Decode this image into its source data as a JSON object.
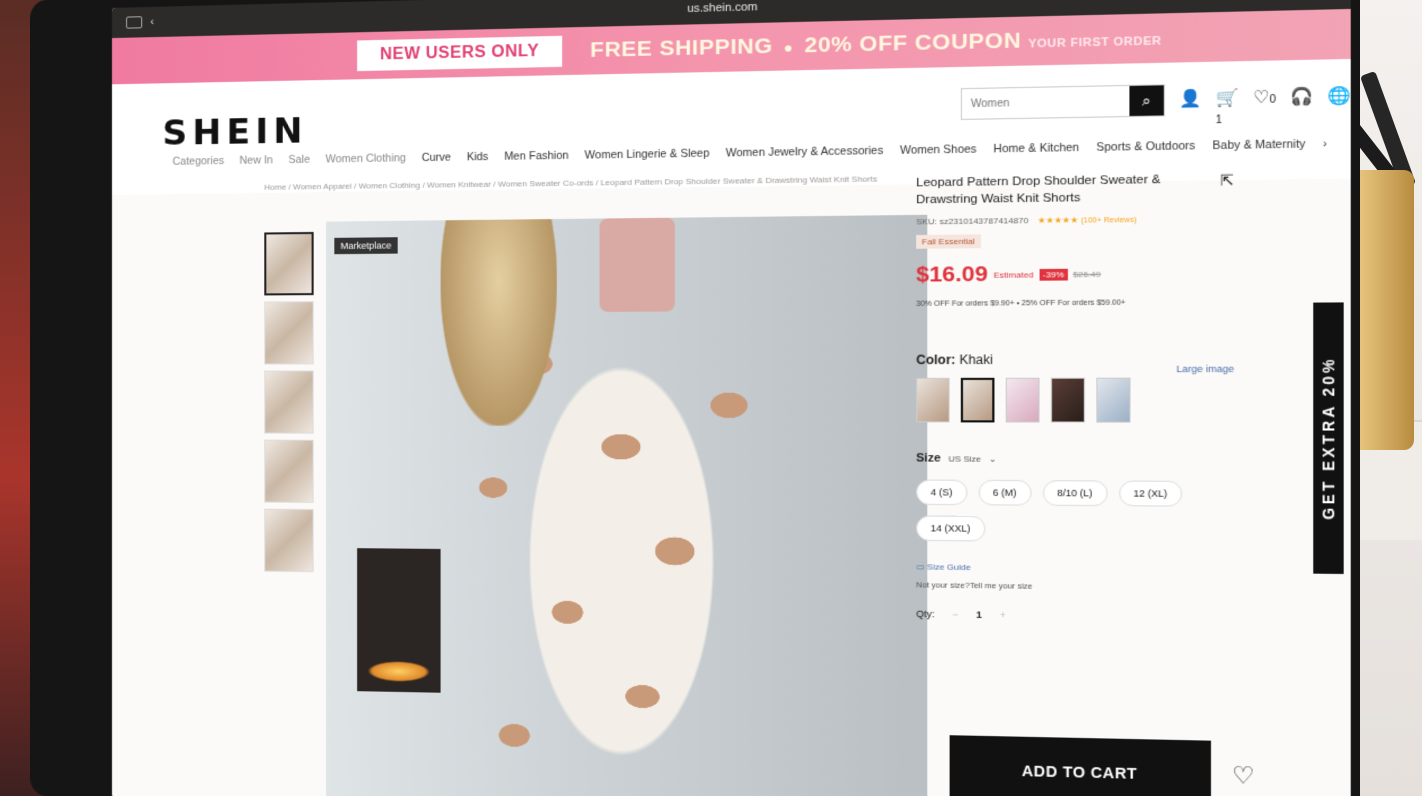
{
  "browser": {
    "url": "us.shein.com"
  },
  "promo": {
    "new_users": "NEW USERS ONLY",
    "free_shipping": "FREE SHIPPING",
    "coupon": "20% OFF COUPON",
    "coupon_sub": "YOUR FIRST ORDER"
  },
  "header": {
    "logo": "SHEIN",
    "search_placeholder": "Women",
    "cart_count": "1",
    "wishlist_count": "0"
  },
  "nav": {
    "items": [
      "Categories",
      "New In",
      "Sale",
      "Women Clothing",
      "Curve",
      "Kids",
      "Men Fashion",
      "Women Lingerie & Sleep",
      "Women Jewelry & Accessories",
      "Women Shoes",
      "Home & Kitchen",
      "Sports & Outdoors",
      "Baby & Maternity"
    ]
  },
  "breadcrumb": "Home / Women Apparel / Women Clothing / Women Knitwear / Women Sweater Co-ords / Leopard Pattern Drop Shoulder Sweater & Drawstring Waist Knit Shorts",
  "gallery": {
    "badge": "Marketplace"
  },
  "product": {
    "title": "Leopard Pattern Drop Shoulder Sweater & Drawstring Waist Knit Shorts",
    "sku": "SKU: sz2310143787414870",
    "reviews": "(100+ Reviews)",
    "tag": "Fall Essential",
    "price": "$16.09",
    "estimated": "Estimated",
    "discount": "-39%",
    "original_price": "$26.49",
    "promo_line": "30% OFF For orders $9.90+ • 25% OFF For orders $59.00+",
    "large_image": "Large image",
    "color_label": "Color:",
    "color_value": "Khaki",
    "size_label": "Size",
    "size_system": "US Size",
    "sizes": [
      "4 (S)",
      "6 (M)",
      "8/10 (L)",
      "12 (XL)",
      "14 (XXL)"
    ],
    "size_guide": "Size Guide",
    "not_your_size": "Not your size?Tell me your size",
    "qty_label": "Qty:",
    "qty_value": "1",
    "add_to_cart": "ADD TO CART"
  },
  "side_tab": "GET EXTRA 20%"
}
